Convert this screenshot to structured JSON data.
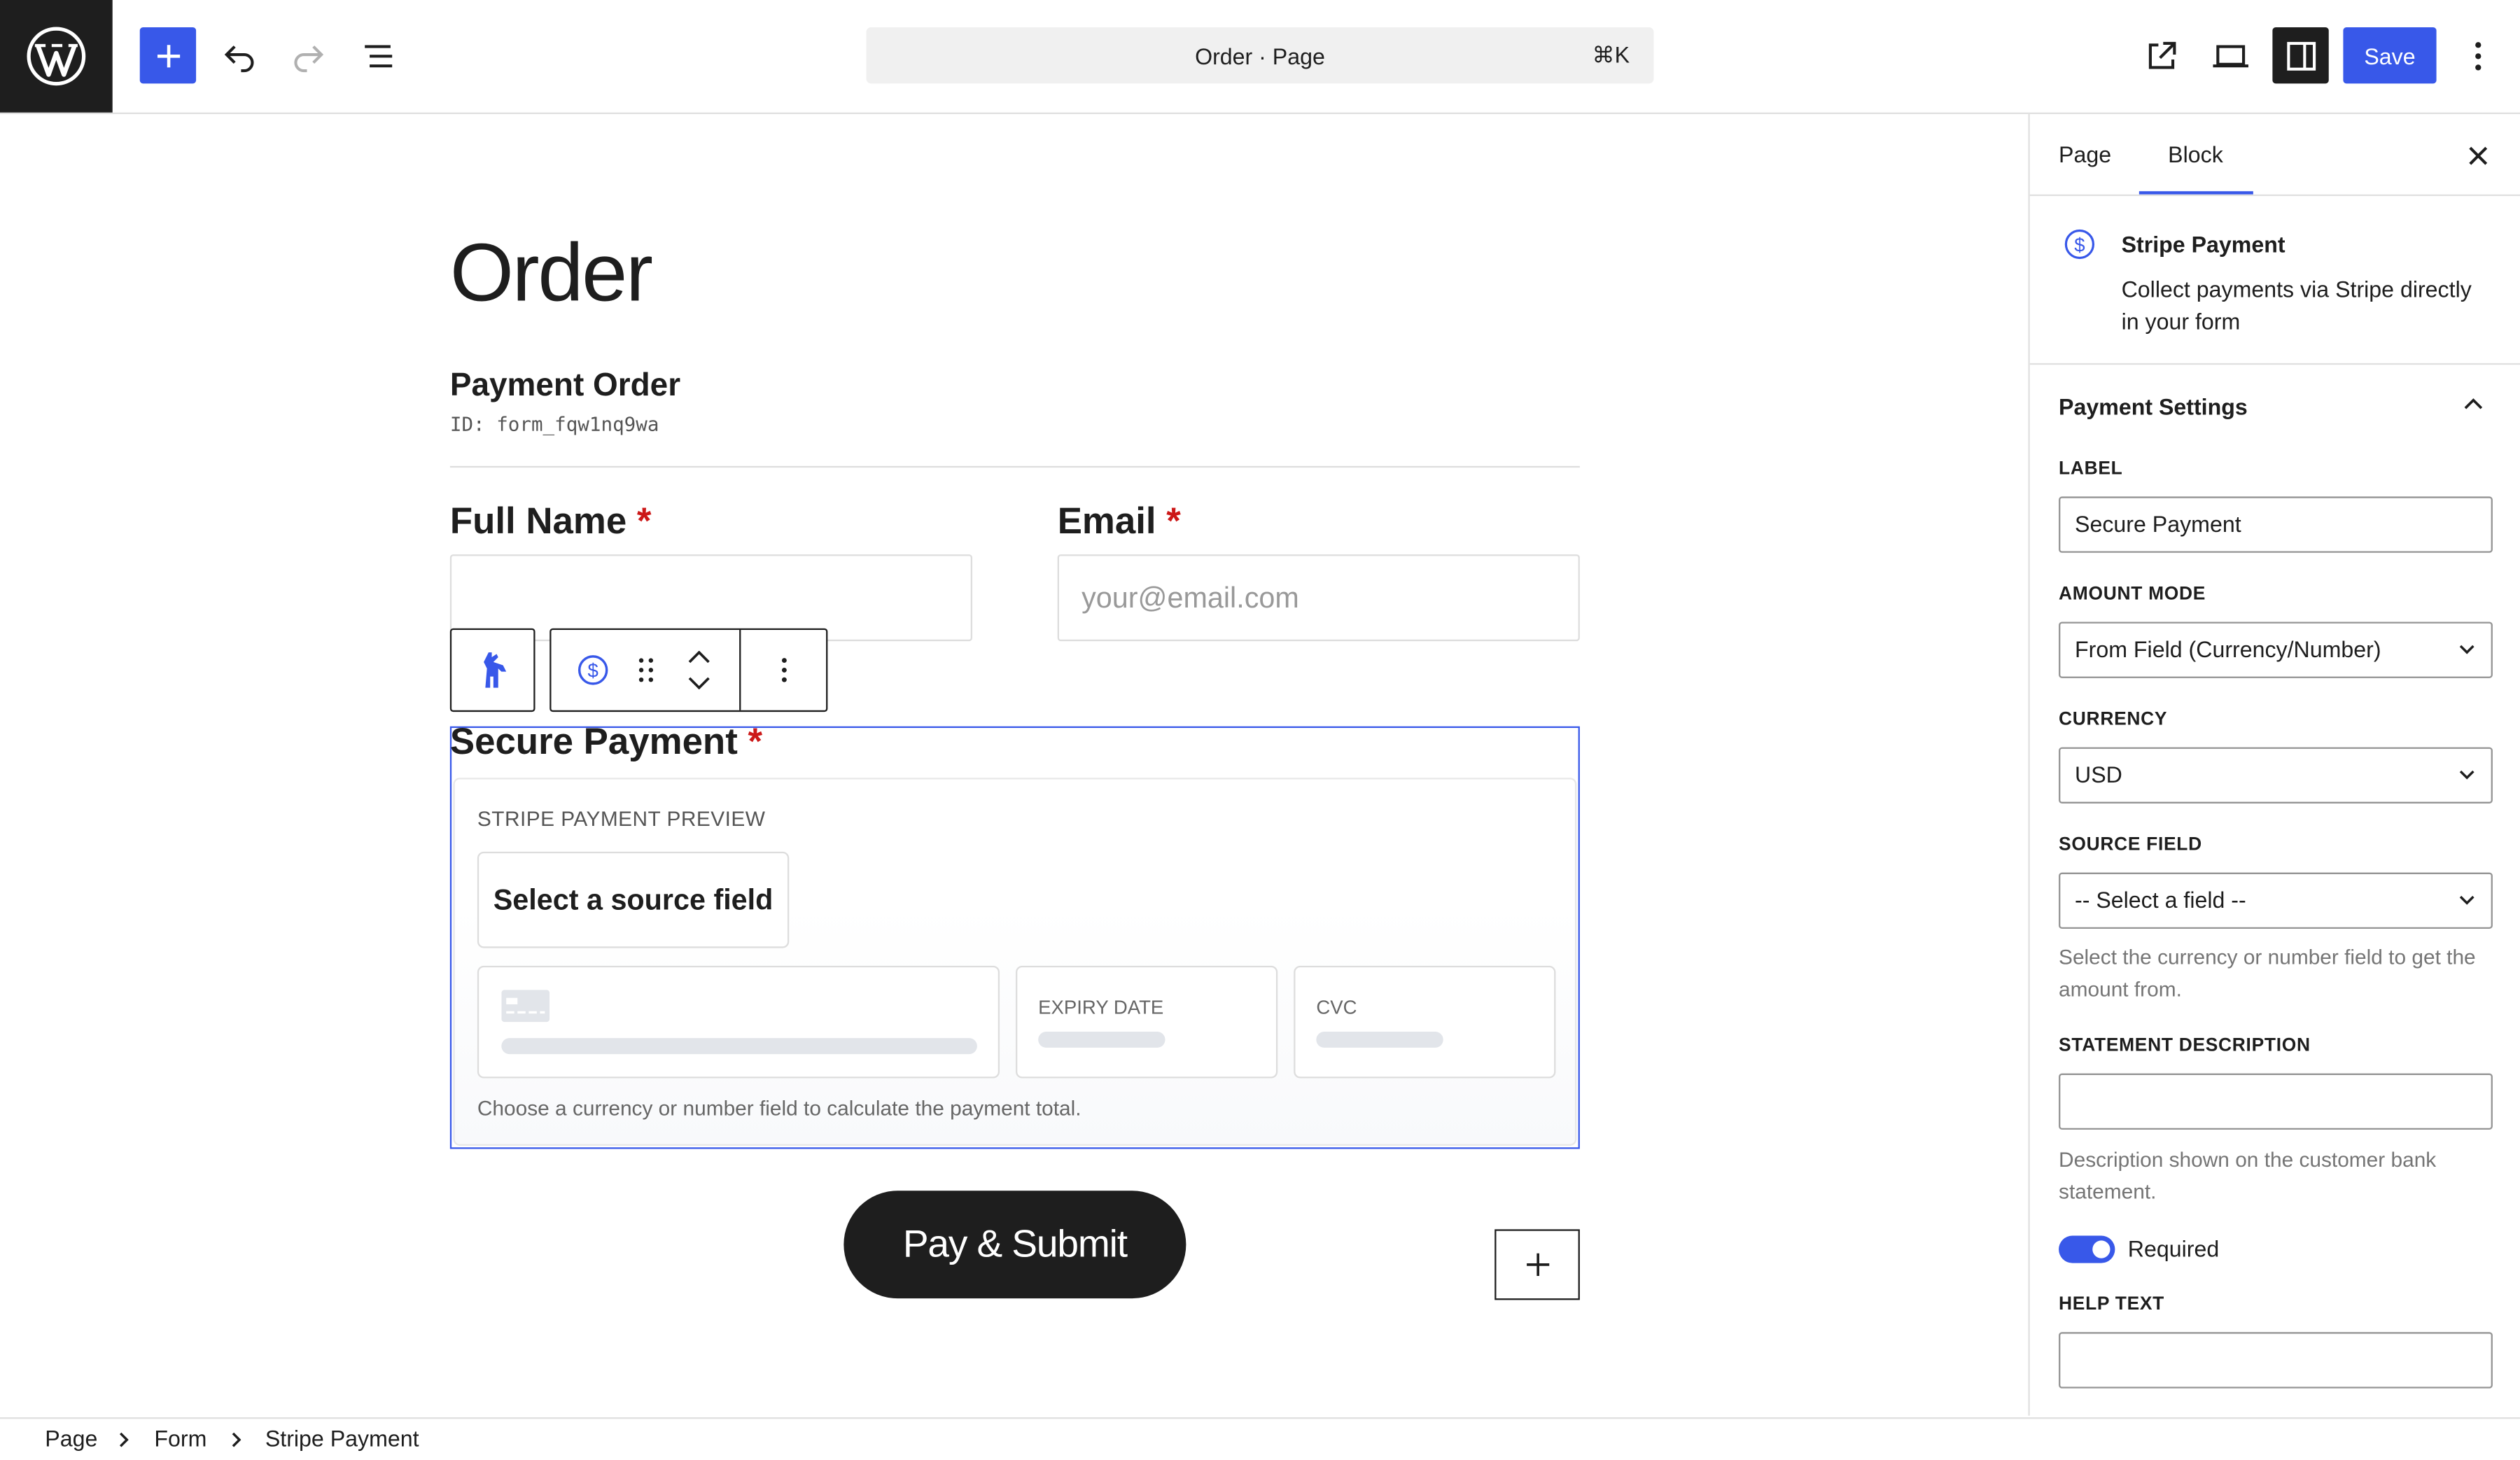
{
  "header": {
    "command_title": "Order · Page",
    "command_shortcut": "⌘K",
    "save_label": "Save"
  },
  "page": {
    "title": "Order",
    "form_name": "Payment Order",
    "form_id": "ID: form_fqw1nq9wa",
    "fields": {
      "full_name_label": "Full Name",
      "email_label": "Email",
      "email_placeholder": "your@email.com",
      "required_mark": "*"
    },
    "payment_block": {
      "label": "Secure Payment",
      "preview_label": "STRIPE PAYMENT PREVIEW",
      "select_source": "Select a source field",
      "expiry_label": "EXPIRY DATE",
      "cvc_label": "CVC",
      "help": "Choose a currency or number field to calculate the payment total."
    },
    "submit_label": "Pay & Submit"
  },
  "sidebar": {
    "tabs": [
      "Page",
      "Block"
    ],
    "active_tab": "Block",
    "block_name": "Stripe Payment",
    "block_description": "Collect payments via Stripe directly in your form",
    "panel_title": "Payment Settings",
    "label_caption": "LABEL",
    "label_value": "Secure Payment",
    "amount_mode_caption": "AMOUNT MODE",
    "amount_mode_value": "From Field (Currency/Number)",
    "currency_caption": "CURRENCY",
    "currency_value": "USD",
    "source_field_caption": "SOURCE FIELD",
    "source_field_value": "-- Select a field --",
    "source_field_help": "Select the currency or number field to get the amount from.",
    "statement_caption": "STATEMENT DESCRIPTION",
    "statement_value": "",
    "statement_help": "Description shown on the customer bank statement.",
    "required_label": "Required",
    "required_on": true,
    "help_text_caption": "HELP TEXT",
    "help_text_value": ""
  },
  "breadcrumbs": [
    "Page",
    "Form",
    "Stripe Payment"
  ],
  "colors": {
    "accent": "#3858e9",
    "dark": "#1e1e1e",
    "required": "#cc1818"
  }
}
